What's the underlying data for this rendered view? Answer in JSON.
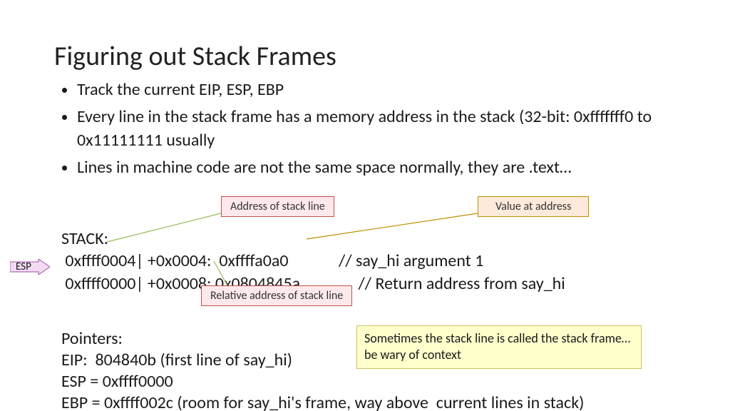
{
  "title": "Figuring out Stack Frames",
  "bullets": {
    "b1": "Track the current EIP, ESP, EBP",
    "b2": "Every line in the stack frame has a memory address in the stack (32-bit: 0xfffffff0 to 0x11111111 usually",
    "b3": "Lines in machine code are not the same space normally, they are .text…"
  },
  "stack": {
    "header": "STACK:",
    "line1": " 0xffff0004| +0x0004:  0xffffa0a0             // say_hi argument 1",
    "line2": " 0xffff0000| +0x0008: 0x0804845a               // Return address from say_hi"
  },
  "pointers": {
    "header": "Pointers:",
    "eip": "EIP:  804840b (first line of say_hi)",
    "esp": "ESP = 0xffff0000",
    "ebp": "EBP = 0xffff002c (room for say_hi's frame, way above  current lines in stack)"
  },
  "callouts": {
    "addr": "Address of stack line",
    "reladdr": "Relative address of stack line",
    "value": "Value at address",
    "note": "Sometimes the stack line is called the stack frame…be wary of context"
  },
  "esp_label": "ESP"
}
